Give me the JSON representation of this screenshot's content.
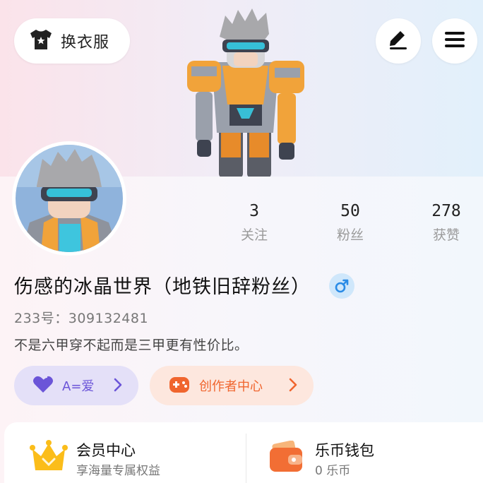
{
  "header": {
    "wardrobe_label": "换衣服",
    "icons": {
      "wardrobe": "tshirt-icon",
      "edit": "pencil-icon",
      "menu": "hamburger-menu-icon"
    }
  },
  "profile": {
    "name": "伤感的冰晶世界（地铁旧辞粉丝）",
    "gender_icon": "male-icon",
    "uid_text": "233号：309132481",
    "bio": "不是六甲穿不起而是三甲更有性价比。"
  },
  "stats": [
    {
      "value": "3",
      "label": "关注"
    },
    {
      "value": "50",
      "label": "粉丝"
    },
    {
      "value": "278",
      "label": "获赞"
    }
  ],
  "pills": {
    "love": {
      "label": "A=爱",
      "icon": "heart-icon"
    },
    "creator": {
      "label": "创作者中心",
      "icon": "gamepad-icon"
    }
  },
  "cards": {
    "vip": {
      "title": "会员中心",
      "subtitle": "享海量专属权益",
      "icon": "crown-icon"
    },
    "wallet": {
      "title": "乐币钱包",
      "subtitle": "0 乐币",
      "icon": "wallet-icon"
    }
  },
  "colors": {
    "accent_purple": "#6b55d8",
    "accent_orange": "#f0652e",
    "gender_blue": "#2a8be6"
  }
}
